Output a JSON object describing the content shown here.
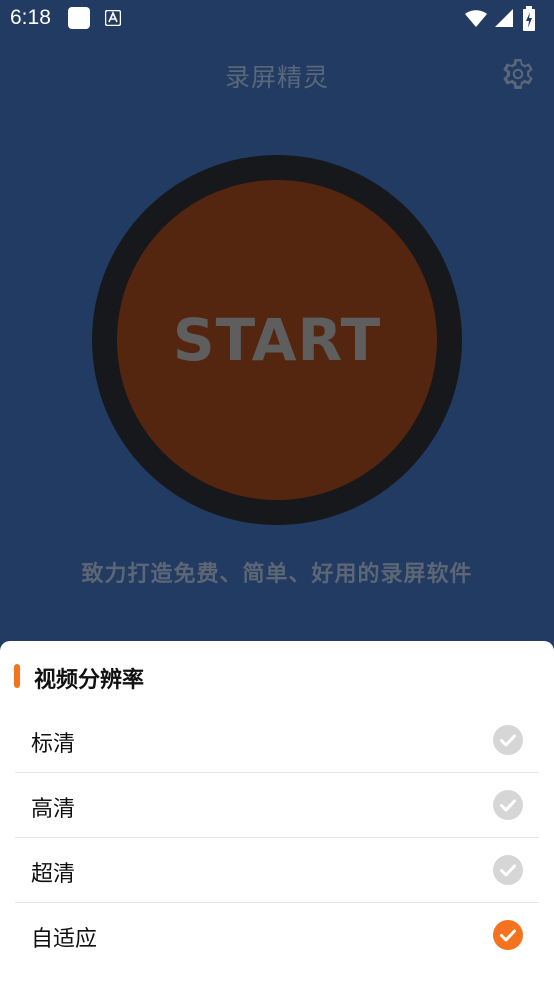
{
  "status_bar": {
    "time": "6:18",
    "icons": [
      "notification-square-icon",
      "notification-a-icon",
      "wifi-icon",
      "signal-icon",
      "battery-charging-icon"
    ]
  },
  "app_bar": {
    "title": "录屏精灵",
    "settings_icon": "gear-icon"
  },
  "main": {
    "record_button_label": "START",
    "tagline": "致力打造免费、简单、好用的录屏软件"
  },
  "resolution_sheet": {
    "title": "视频分辨率",
    "options": [
      {
        "label": "标清",
        "selected": false
      },
      {
        "label": "高清",
        "selected": false
      },
      {
        "label": "超清",
        "selected": false
      },
      {
        "label": "自适应",
        "selected": true
      }
    ]
  },
  "colors": {
    "background": "#223B63",
    "accent": "#F5731F",
    "record_button": "#55260F",
    "record_ring": "#16181B",
    "check_inactive": "#D6D6D6",
    "check_active": "#F5731F"
  }
}
